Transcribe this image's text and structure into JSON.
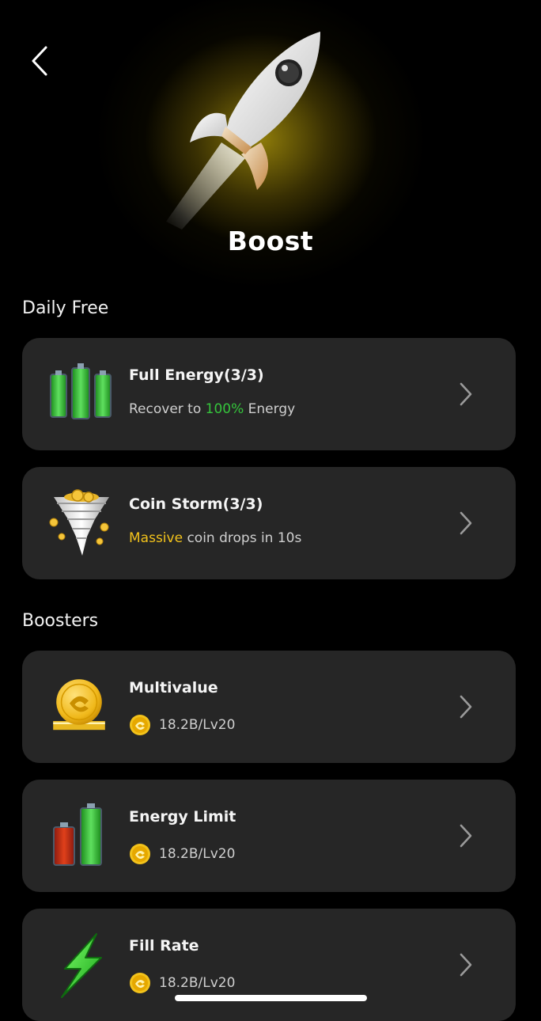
{
  "header": {
    "title": "Boost",
    "back_icon": "chevron-left-icon"
  },
  "sections": [
    {
      "title": "Daily Free"
    },
    {
      "title": "Boosters"
    }
  ],
  "daily": [
    {
      "name": "Full Energy(3/3)",
      "desc_prefix": "Recover to ",
      "desc_highlight": "100%",
      "desc_suffix": " Energy",
      "icon": "battery-icon",
      "highlight_color": "#35c53c"
    },
    {
      "name": "Coin Storm(3/3)",
      "desc_highlight": "Massive",
      "desc_suffix": " coin drops in 10s",
      "icon": "tornado-coins-icon",
      "highlight_color": "#f2c21b"
    }
  ],
  "boosters": [
    {
      "name": "Multivalue",
      "cost": "18.2B/Lv20",
      "icon": "gold-coin-icon"
    },
    {
      "name": "Energy Limit",
      "cost": "18.2B/Lv20",
      "icon": "energy-bars-icon"
    },
    {
      "name": "Fill Rate",
      "cost": "18.2B/Lv20",
      "icon": "lightning-icon"
    }
  ]
}
